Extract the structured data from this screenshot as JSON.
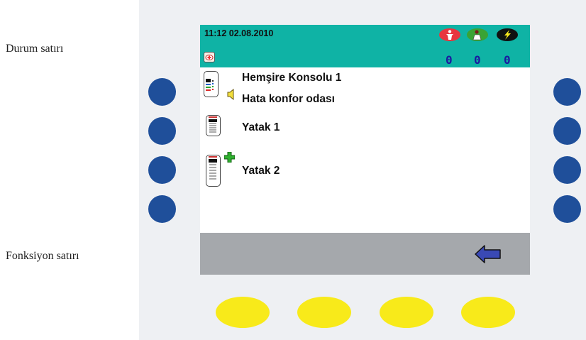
{
  "labels": {
    "status_line": "Durum satırı",
    "function_line": "Fonksiyon satırı"
  },
  "status": {
    "datetime": "11:12 02.08.2010",
    "icons": [
      "nurse-call-icon",
      "doctor-call-icon",
      "emergency-lightning-icon"
    ],
    "counts": [
      "0",
      "0",
      "0"
    ],
    "colors": {
      "bar": "#0fb3a5",
      "nurse": "#e8363f",
      "doctor": "#3aa335",
      "emergency": "#111111"
    }
  },
  "list": {
    "console_name": "Hemşire Konsolu 1",
    "console_status": "Hata konfor odası",
    "beds": [
      "Yatak  1",
      "Yatak  2"
    ]
  },
  "function_bar": {
    "back_icon": "back-arrow-icon"
  }
}
